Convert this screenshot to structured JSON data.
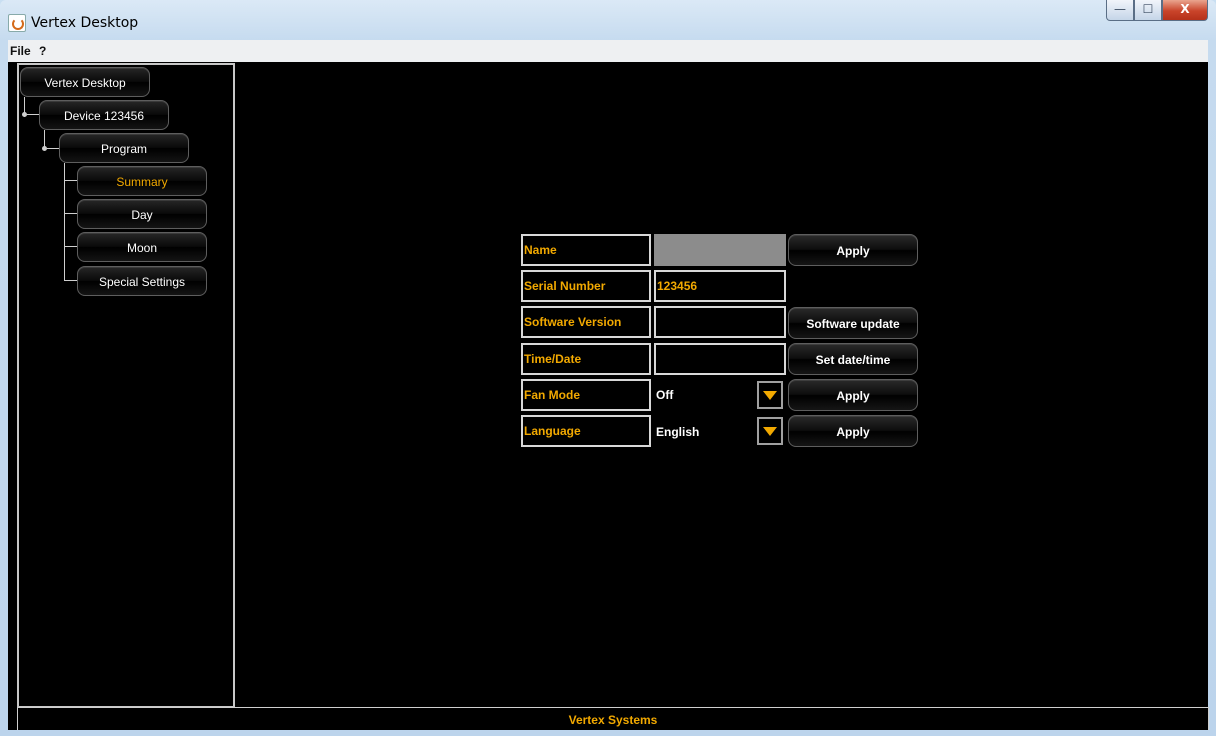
{
  "window": {
    "title": "Vertex Desktop",
    "controls": {
      "minimize": "—",
      "maximize": "☐",
      "close": "X"
    }
  },
  "menu": {
    "items": [
      "File",
      "?"
    ]
  },
  "tree": {
    "root": "Vertex Desktop",
    "device": "Device 123456",
    "program": "Program",
    "children": [
      "Summary",
      "Day",
      "Moon",
      "Special Settings"
    ],
    "selected": "Summary"
  },
  "form": {
    "name": {
      "label": "Name",
      "value": "",
      "button": "Apply"
    },
    "serial": {
      "label": "Serial Number",
      "value": "123456"
    },
    "software": {
      "label": "Software Version",
      "value": "",
      "button": "Software update"
    },
    "time": {
      "label": "Time/Date",
      "value": "",
      "button": "Set date/time"
    },
    "fan": {
      "label": "Fan Mode",
      "value": "Off",
      "button": "Apply"
    },
    "language": {
      "label": "Language",
      "value": "English",
      "button": "Apply"
    }
  },
  "status": {
    "text": "Vertex Systems"
  },
  "colors": {
    "accent": "#f2a900",
    "background": "#000000",
    "border": "#d8d8d8"
  }
}
